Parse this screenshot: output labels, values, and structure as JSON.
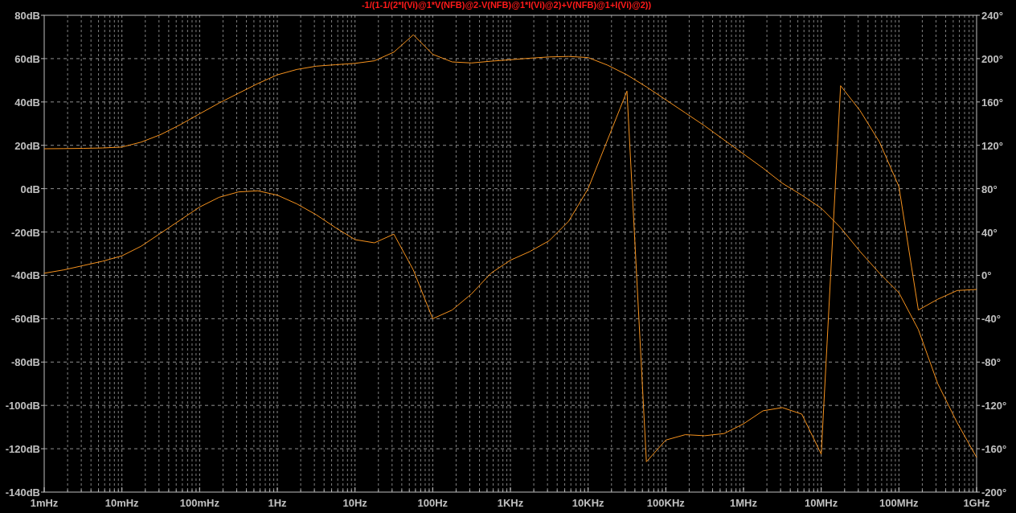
{
  "plot": {
    "title": "-1/(1-1/(2*I(Vi)@1*V(NFB)@2-V(NFB)@1*I(Vi)@2)+V(NFB)@1+I(Vi)@2))",
    "magnitude": {
      "chart_data": {
        "type": "line",
        "ylim": [
          -140,
          80
        ],
        "categories": [
          "1mHz",
          null,
          null,
          null,
          "10mHz",
          null,
          null,
          null,
          "100mHz",
          null,
          null,
          null,
          "1Hz",
          null,
          null,
          null,
          "10Hz",
          null,
          null,
          null,
          "100Hz",
          null,
          null,
          null,
          "1KHz",
          null,
          null,
          null,
          "10KHz",
          null,
          null,
          null,
          "100KHz",
          null,
          null,
          null,
          "1MHz",
          null,
          null,
          null,
          "10MHz",
          null,
          null,
          null,
          "100MHz",
          null,
          null,
          null,
          "1GHz"
        ],
        "yticks": [
          {
            "value": 80,
            "label": "80dB"
          },
          {
            "value": 60,
            "label": "60dB"
          },
          {
            "value": 40,
            "label": "40dB"
          },
          {
            "value": 20,
            "label": "20dB"
          },
          {
            "value": 0,
            "label": "0dB"
          },
          {
            "value": -20,
            "label": "-20dB"
          },
          {
            "value": -40,
            "label": "-40dB"
          },
          {
            "value": -60,
            "label": "-60dB"
          },
          {
            "value": -80,
            "label": "-80dB"
          },
          {
            "value": -100,
            "label": "-100dB"
          },
          {
            "value": -120,
            "label": "-120dB"
          },
          {
            "value": -140,
            "label": "-140dB"
          }
        ],
        "series": [
          {
            "color": "#f7931e",
            "values": [
              18.4,
              18.5,
              18.6,
              18.8,
              19.2,
              21.5,
              25,
              29.5,
              34.5,
              39.5,
              44,
              48.5,
              52.5,
              55,
              56.5,
              57.2,
              57.8,
              59,
              63,
              71,
              62,
              58.5,
              58,
              58.8,
              59.5,
              60.2,
              60.8,
              61,
              60.5,
              57,
              52.5,
              47,
              41,
              35,
              29,
              22.5,
              16,
              9.5,
              2.5,
              -3,
              -9,
              -18,
              -29,
              -39,
              -48,
              -65,
              -90,
              -108,
              -124
            ]
          }
        ]
      }
    },
    "phase": {
      "chart_data": {
        "type": "line",
        "ylim": [
          -200,
          240
        ],
        "categories": [
          null,
          null,
          null,
          null,
          null,
          null,
          null,
          null,
          null,
          null,
          null,
          null,
          null,
          null,
          null,
          null,
          null,
          null,
          null,
          null,
          null,
          null,
          null,
          null,
          null,
          null,
          null,
          null,
          null,
          null,
          null,
          null,
          null,
          null,
          null,
          null,
          null,
          null,
          null,
          null,
          null,
          null,
          null,
          null,
          null,
          null,
          null,
          null,
          null
        ],
        "yticks": [
          {
            "value": 240,
            "label": "240°"
          },
          {
            "value": 200,
            "label": "200°"
          },
          {
            "value": 160,
            "label": "160°"
          },
          {
            "value": 120,
            "label": "120°"
          },
          {
            "value": 80,
            "label": "80°"
          },
          {
            "value": 40,
            "label": "40°"
          },
          {
            "value": 0,
            "label": "0°"
          },
          {
            "value": -40,
            "label": "-40°"
          },
          {
            "value": -80,
            "label": "-80°"
          },
          {
            "value": -120,
            "label": "-120°"
          },
          {
            "value": -160,
            "label": "-160°"
          },
          {
            "value": -200,
            "label": "-200°"
          }
        ],
        "series": [
          {
            "color": "#f7931e",
            "values": [
              2,
              5,
              9,
              13,
              18,
              27,
              39,
              51,
              63,
              72,
              77,
              78,
              74,
              66,
              56,
              44,
              33,
              30,
              38,
              5,
              -40,
              -32,
              -17,
              2,
              14,
              22,
              32,
              50,
              80,
              125,
              170,
              -172,
              -152,
              -147,
              -148,
              -146,
              -137,
              -125,
              -122,
              -128,
              -165,
              175,
              152,
              123,
              82,
              -32,
              -22,
              -14,
              -13
            ]
          }
        ]
      }
    }
  }
}
